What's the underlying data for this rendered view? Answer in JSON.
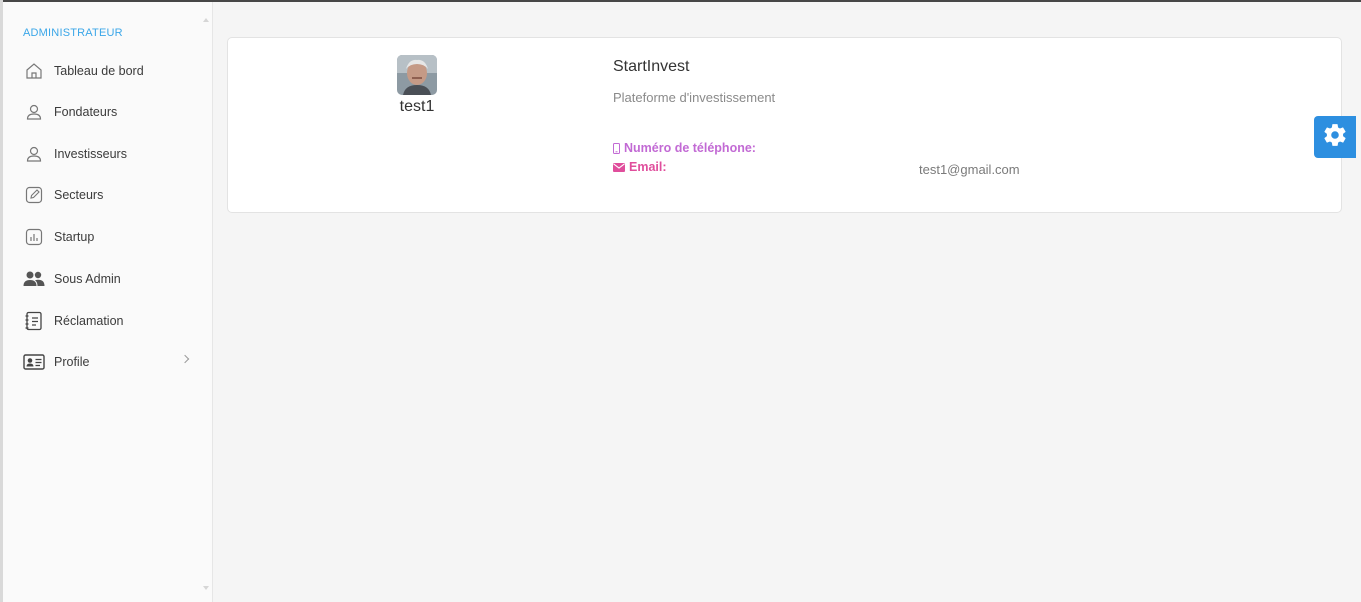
{
  "sidebar": {
    "section_title": "ADMINISTRATEUR",
    "items": [
      {
        "label": "Tableau de bord",
        "icon": "home-icon"
      },
      {
        "label": "Fondateurs",
        "icon": "user-icon"
      },
      {
        "label": "Investisseurs",
        "icon": "user-icon"
      },
      {
        "label": "Secteurs",
        "icon": "edit-icon"
      },
      {
        "label": "Startup",
        "icon": "bar-chart-icon"
      },
      {
        "label": "Sous Admin",
        "icon": "users-icon"
      },
      {
        "label": "Réclamation",
        "icon": "notebook-icon"
      },
      {
        "label": "Profile",
        "icon": "id-card-icon"
      }
    ]
  },
  "profile": {
    "username": "test1",
    "company": "StartInvest",
    "tagline": "Plateforme d'investissement",
    "phone_label": "Numéro de téléphone:",
    "email_label": "Email:",
    "email_value": "test1@gmail.com"
  },
  "colors": {
    "accent_blue": "#2d8fe0",
    "section_title": "#3aa6e8",
    "phone_label": "#c26ad4",
    "email_label": "#e04e9c"
  }
}
